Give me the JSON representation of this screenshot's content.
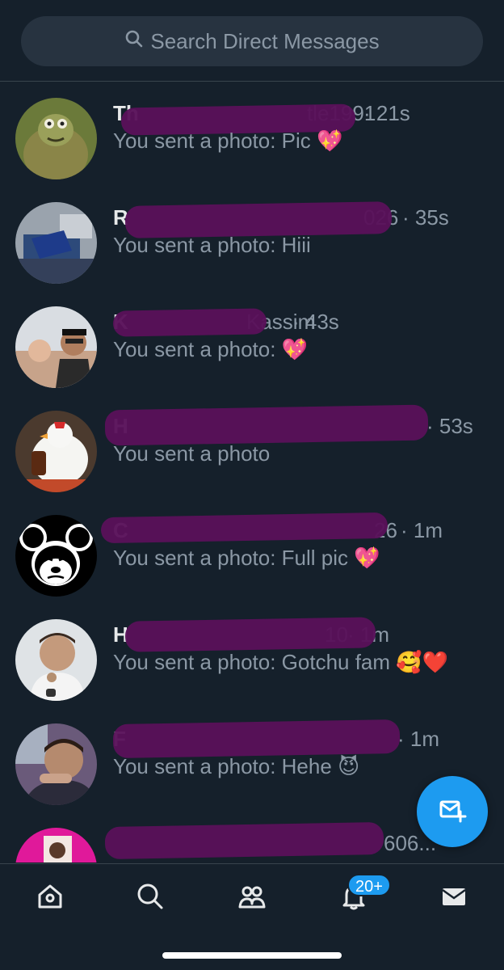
{
  "search": {
    "placeholder": "Search Direct Messages"
  },
  "conversations": [
    {
      "name_visible": "Th",
      "handle_tail": "tle1991",
      "time": "21s",
      "preview": "You sent a photo: Pic",
      "emoji": "💖"
    },
    {
      "name_visible": "R",
      "handle_tail": "026",
      "time": "35s",
      "preview": "You sent a photo: Hiii",
      "emoji": ""
    },
    {
      "name_visible": "K",
      "handle_tail": "Kassim",
      "time": "43s",
      "preview": "You sent a photo:",
      "emoji": "💖"
    },
    {
      "name_visible": "H",
      "handle_tail": "",
      "time": "53s",
      "preview": "You sent a photo",
      "emoji": ""
    },
    {
      "name_visible": "C",
      "handle_tail": "26",
      "time": "1m",
      "preview": "You sent a photo: Full pic",
      "emoji": "💖"
    },
    {
      "name_visible": "H",
      "handle_tail": "10",
      "time": "1m",
      "preview": "You sent a photo: Gotchu fam",
      "emoji": "🥰❤️"
    },
    {
      "name_visible": "F",
      "handle_tail": "",
      "time": "1m",
      "preview": "You sent a photo: Hehe",
      "emoji": "😈"
    },
    {
      "name_visible": "",
      "handle_tail": "606...",
      "time": "",
      "preview": "",
      "emoji": ""
    }
  ],
  "tabbar": {
    "notifications_badge": "20+"
  },
  "colors": {
    "background": "#15202b",
    "accent": "#1d9bf0",
    "redaction": "#5a1159",
    "secondary_text": "#8b98a5"
  },
  "icons": [
    "search-icon",
    "new-message-icon",
    "home-icon",
    "explore-icon",
    "communities-icon",
    "notifications-icon",
    "messages-icon"
  ]
}
